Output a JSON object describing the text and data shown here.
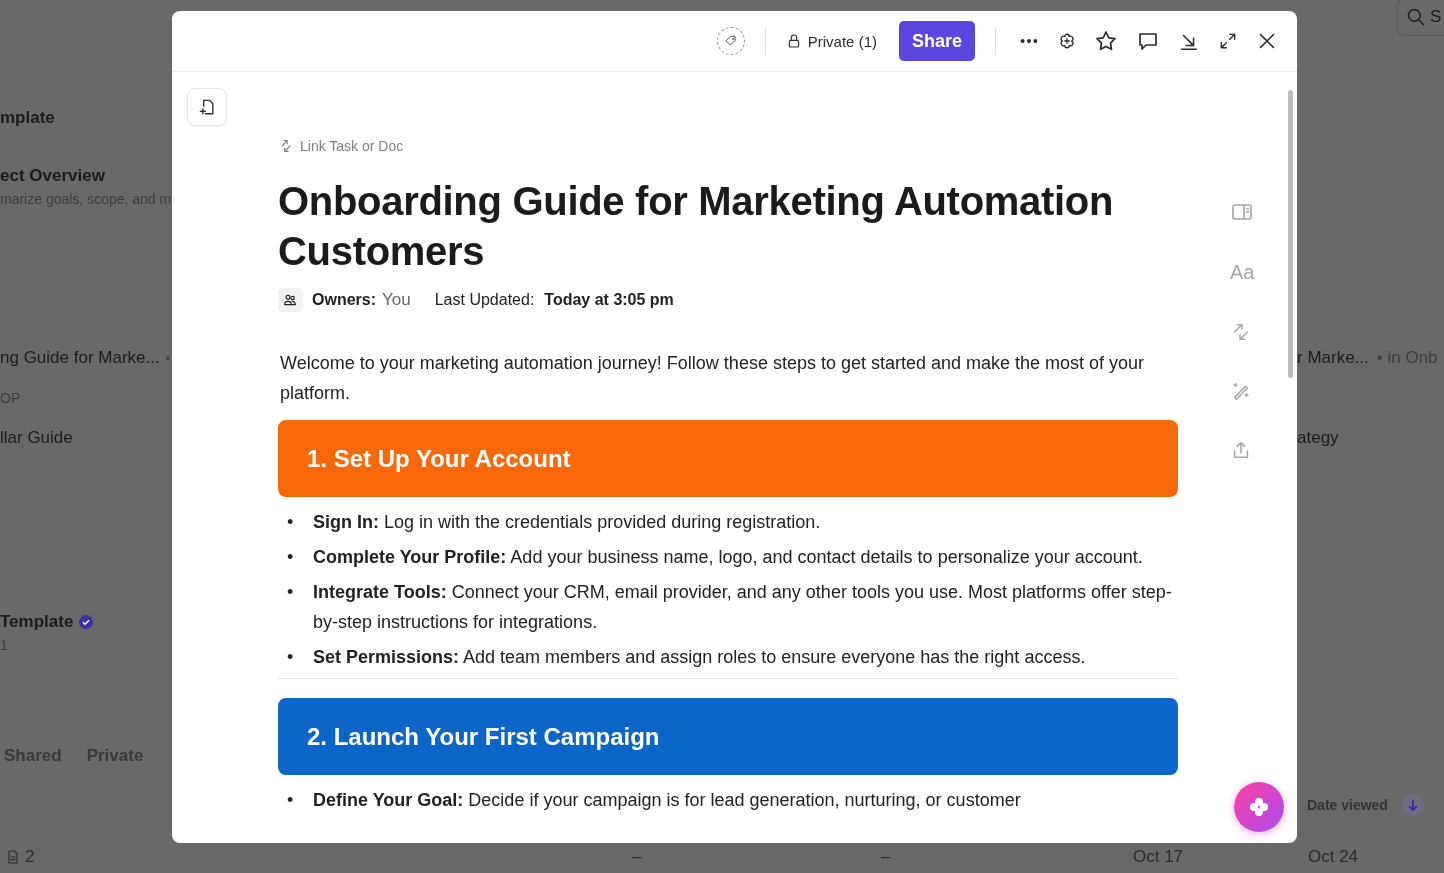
{
  "background": {
    "left_items": [
      {
        "text": "mplate",
        "kind": "title"
      },
      {
        "text": "ect Overview",
        "kind": "title"
      },
      {
        "text": "marize goals, scope, and m",
        "kind": "muted"
      },
      {
        "text": "ng Guide for Marke...",
        "kind": "text",
        "dot": "•"
      },
      {
        "text": "OP",
        "kind": "muted"
      },
      {
        "text": "llar Guide",
        "kind": "text"
      },
      {
        "text": "Template",
        "kind": "title",
        "verified": true
      },
      {
        "text": "1",
        "kind": "muted"
      }
    ],
    "tabs": [
      "Shared",
      "Private"
    ],
    "search": {
      "placeholder": "S"
    },
    "right_items": [
      {
        "text": "r Marke...",
        "suffix": "• in Onb"
      },
      {
        "text": "ategy"
      }
    ],
    "sort_column": "Date viewed",
    "bottom_row": [
      "2",
      "–",
      "–",
      "Oct 17",
      "Oct 24"
    ]
  },
  "modal": {
    "privacy": "Private (1)",
    "share": "Share",
    "link_label": "Link Task or Doc",
    "title": "Onboarding Guide for Marketing Automation Customers",
    "owners_label": "Owners:",
    "owners_value": "You",
    "updated_label": "Last Updated:",
    "updated_value": "Today at 3:05 pm",
    "font_button": "Aa",
    "bullet": "•",
    "intro": "Welcome to your marketing automation journey! Follow these steps to get started and make the most of your platform.",
    "sections": [
      {
        "heading": "1. Set Up Your Account",
        "color": "#f76808",
        "items": [
          "**Sign In:** Log in with the credentials provided during registration.",
          "**Complete Your Profile:** Add your business name, logo, and contact details to personalize your account.",
          "**Integrate Tools:** Connect your CRM, email provider, and any other tools you use. Most platforms offer step-by-step instructions for integrations.",
          "**Set Permissions:** Add team members and assign roles to ensure everyone has the right access."
        ]
      },
      {
        "heading": "2. Launch Your First Campaign",
        "color": "#0b66c8",
        "items": [
          "**Define Your Goal:** Decide if your campaign is for lead generation, nurturing, or customer"
        ]
      }
    ]
  }
}
